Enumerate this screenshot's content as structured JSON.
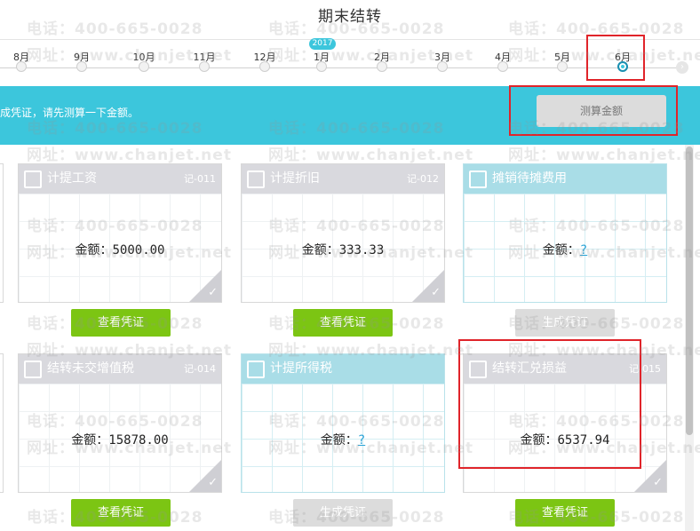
{
  "header": {
    "title": "期末结转"
  },
  "timeline": {
    "year_badge": "2017",
    "months": [
      "8月",
      "9月",
      "10月",
      "11月",
      "12月",
      "1月",
      "2月",
      "3月",
      "4月",
      "5月",
      "6月"
    ],
    "active_index": 10
  },
  "banner": {
    "message": "生成凭证，请先测算一下金额。",
    "calc_button": "测算金额"
  },
  "cards": [
    {
      "title": "计提工资",
      "code": "记-011",
      "amount_label": "金额：",
      "amount": "5000.00",
      "button": "查看凭证"
    },
    {
      "title": "计提折旧",
      "code": "记-012",
      "amount_label": "金额：",
      "amount": "333.33",
      "button": "查看凭证"
    },
    {
      "title": "摊销待摊费用",
      "code": "",
      "amount_label": "金额：",
      "amount": "?",
      "button": "生成凭证"
    },
    {
      "title": "结转未交增值税",
      "code": "记-014",
      "amount_label": "金额：",
      "amount": "15878.00",
      "button": "查看凭证"
    },
    {
      "title": "计提所得税",
      "code": "",
      "amount_label": "金额：",
      "amount": "?",
      "button": "生成凭证"
    },
    {
      "title": "结转汇兑损益",
      "code": "记-015",
      "amount_label": "金额：",
      "amount": "6537.94",
      "button": "查看凭证"
    }
  ],
  "watermark": {
    "phone": "电话：400-665-0028",
    "site": "网址：www.chanjet.net"
  },
  "colors": {
    "accent": "#3cc6dc",
    "done_button": "#7cc513",
    "pending_button": "#dcdcdc",
    "highlight": "#e0242a"
  },
  "icons": {
    "card_0": "wallet-icon",
    "card_1": "docs-icon",
    "card_2": "coins-icon",
    "card_3": "yen-icon",
    "card_4": "clipboard-check-icon",
    "card_5": "clipboard-icon"
  }
}
